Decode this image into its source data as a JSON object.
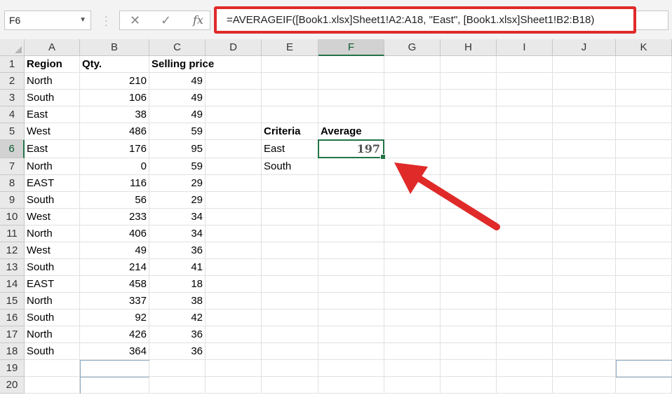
{
  "name_box": {
    "value": "F6"
  },
  "formula_bar": {
    "formula": "=AVERAGEIF([Book1.xlsx]Sheet1!A2:A18, \"East\", [Book1.xlsx]Sheet1!B2:B18)",
    "cancel_icon": "close-icon",
    "enter_icon": "check-icon",
    "function_label": "fx"
  },
  "columns": [
    "A",
    "B",
    "C",
    "D",
    "E",
    "F",
    "G",
    "H",
    "I",
    "J",
    "K"
  ],
  "rows": [
    "1",
    "2",
    "3",
    "4",
    "5",
    "6",
    "7",
    "8",
    "9",
    "10",
    "11",
    "12",
    "13",
    "14",
    "15",
    "16",
    "17",
    "18",
    "19",
    "20"
  ],
  "active_cell": "F6",
  "table": {
    "headers": [
      "Region",
      "Qty.",
      "Selling price"
    ],
    "data": [
      [
        "North",
        "210",
        "49"
      ],
      [
        "South",
        "106",
        "49"
      ],
      [
        "East",
        "38",
        "49"
      ],
      [
        "West",
        "486",
        "59"
      ],
      [
        "East",
        "176",
        "95"
      ],
      [
        "North",
        "0",
        "59"
      ],
      [
        "EAST",
        "116",
        "29"
      ],
      [
        "South",
        "56",
        "29"
      ],
      [
        "West",
        "233",
        "34"
      ],
      [
        "North",
        "406",
        "34"
      ],
      [
        "West",
        "49",
        "36"
      ],
      [
        "South",
        "214",
        "41"
      ],
      [
        "EAST",
        "458",
        "18"
      ],
      [
        "North",
        "337",
        "38"
      ],
      [
        "South",
        "92",
        "42"
      ],
      [
        "North",
        "426",
        "36"
      ],
      [
        "South",
        "364",
        "36"
      ]
    ]
  },
  "criteria_table": {
    "criteria_header": "Criteria",
    "average_header": "Average",
    "rows": [
      {
        "criteria": "East",
        "average": "197"
      },
      {
        "criteria": "South",
        "average": ""
      }
    ]
  },
  "colors": {
    "highlight_border": "#e02a2a",
    "arrow": "#e02a2a",
    "selection": "#217346"
  }
}
